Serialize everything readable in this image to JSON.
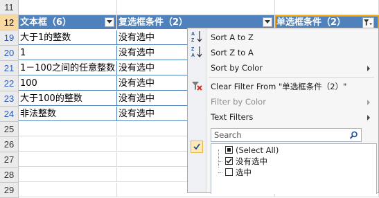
{
  "sheet": {
    "rows": [
      {
        "num": "11",
        "cells": [
          "",
          "",
          ""
        ]
      },
      {
        "num": "12",
        "cells": [
          "文本框（6）",
          "复选框条件（2）",
          "单选框条件（2）"
        ],
        "header": true
      },
      {
        "num": "19",
        "cells": [
          "大于1的整数",
          "没有选中",
          ""
        ],
        "data": true
      },
      {
        "num": "20",
        "cells": [
          "1",
          "没有选中",
          ""
        ],
        "data": true
      },
      {
        "num": "21",
        "cells": [
          "1－100之间的任意整数",
          "没有选中",
          ""
        ],
        "data": true
      },
      {
        "num": "22",
        "cells": [
          "100",
          "没有选中",
          ""
        ],
        "data": true
      },
      {
        "num": "23",
        "cells": [
          "大于100的整数",
          "没有选中",
          ""
        ],
        "data": true
      },
      {
        "num": "24",
        "cells": [
          "非法整数",
          "没有选中",
          ""
        ],
        "data": true
      },
      {
        "num": "25",
        "cells": [
          "",
          "",
          ""
        ]
      },
      {
        "num": "26",
        "cells": [
          "",
          "",
          ""
        ]
      },
      {
        "num": "27",
        "cells": [
          "",
          "",
          ""
        ]
      },
      {
        "num": "28",
        "cells": [
          "",
          "",
          ""
        ]
      },
      {
        "num": "29",
        "cells": [
          "",
          "",
          ""
        ]
      }
    ],
    "colors": {
      "header_bg": "#4f81bd",
      "selected_rownum": "#f9d99f",
      "active_border": "#f2a000"
    }
  },
  "filter_menu": {
    "sort_a_to_z": "Sort A to Z",
    "sort_z_to_a": "Sort Z to A",
    "sort_by_color": "Sort by Color",
    "clear_filter": "Clear Filter From \"单选框条件（2）\"",
    "filter_by_color": "Filter by Color",
    "text_filters": "Text Filters",
    "search_placeholder": "Search",
    "options": [
      {
        "label": "(Select All)",
        "state": "partial"
      },
      {
        "label": "没有选中",
        "state": "checked"
      },
      {
        "label": "选中",
        "state": "unchecked"
      }
    ]
  }
}
